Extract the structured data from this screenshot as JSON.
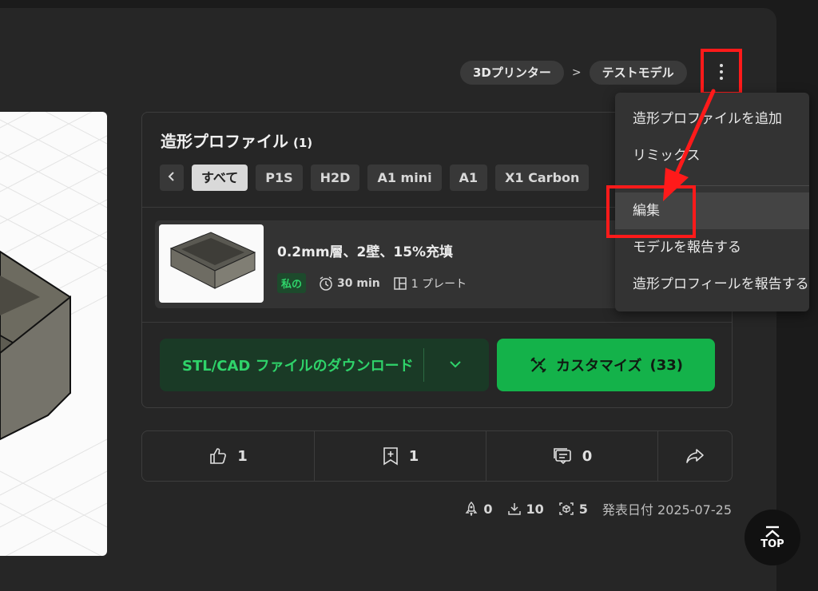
{
  "breadcrumb": {
    "items": [
      "3Dプリンター",
      "テストモデル"
    ],
    "separator": ">"
  },
  "more_button": {
    "icon": "more-vertical-icon"
  },
  "profiles": {
    "title": "造形プロファイル",
    "count": "(1)",
    "filters": [
      "すべて",
      "P1S",
      "H2D",
      "A1 mini",
      "A1",
      "X1 Carbon"
    ],
    "active_filter": "すべて",
    "item": {
      "title": "0.2mm層、2壁、15%充填",
      "tag": "私の",
      "time": "30 min",
      "plates": "1 プレート"
    }
  },
  "actions": {
    "download_label": "STL/CAD ファイルのダウンロード",
    "customize_label": "カスタマイズ",
    "customize_count": "(33)"
  },
  "stats": {
    "likes": "1",
    "collects": "1",
    "comments": "0"
  },
  "footer": {
    "boosts": "0",
    "downloads": "10",
    "prints": "5",
    "published": "発表日付 2025-07-25"
  },
  "top_button": {
    "label": "TOP"
  },
  "menu": {
    "items": [
      "造形プロファイルを追加",
      "リミックス",
      "編集",
      "モデルを報告する",
      "造形プロフィールを報告する"
    ],
    "hovered": "編集"
  },
  "colors": {
    "accent_green": "#14b24a",
    "annotation_red": "#ff1a1a"
  }
}
